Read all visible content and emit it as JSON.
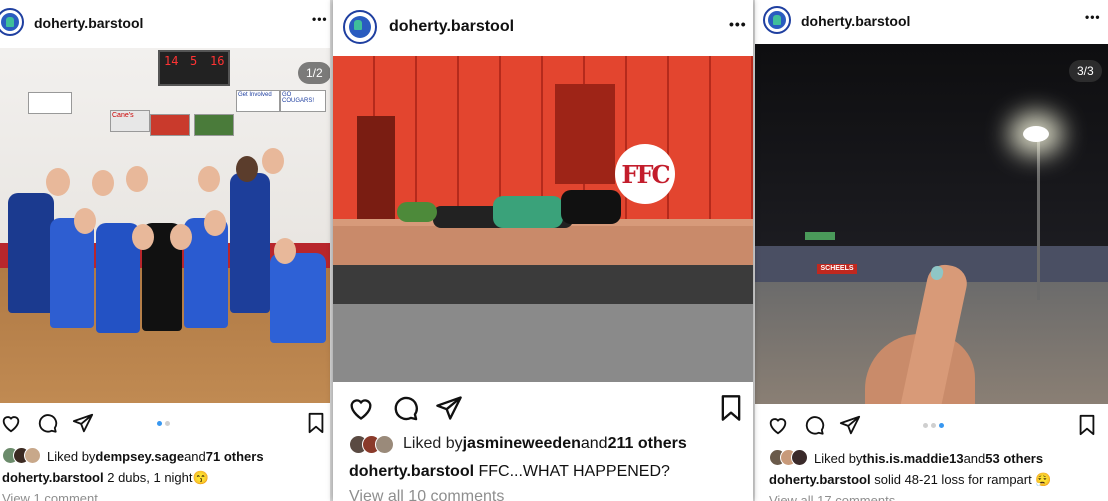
{
  "colors": {
    "link_blue": "#3897f0",
    "school_blue": "#1f3fa0",
    "text": "#111111",
    "muted": "#8e8e8e"
  },
  "posts": [
    {
      "username": "doherty.barstool",
      "more": "•••",
      "counter": "1/2",
      "scoreboard": [
        "14",
        "5",
        "16"
      ],
      "photo_signs": [
        "GO COUGARS!",
        "Get Involved",
        "Cane's",
        "GO COUGARS!"
      ],
      "likes_prefix": "Liked by ",
      "likes_user": "dempsey.sage",
      "likes_and": " and ",
      "likes_others": "71 others",
      "caption_user": "doherty.barstool",
      "caption_text": " 2 dubs, 1 night😙",
      "comments": "View 1 comment",
      "carousel_dots": 2,
      "carousel_active": 0
    },
    {
      "username": "doherty.barstool",
      "more": "•••",
      "logo_text": "FFC",
      "likes_prefix": "Liked by ",
      "likes_user": "jasmineweeden",
      "likes_and": " and ",
      "likes_others": "211 others",
      "caption_user": "doherty.barstool",
      "caption_text": " FFC...WHAT HAPPENED?",
      "comments": "View all 10 comments"
    },
    {
      "username": "doherty.barstool",
      "more": "•••",
      "counter": "3/3",
      "photo_sign": "SCHEELS",
      "likes_prefix": "Liked by ",
      "likes_user": "this.is.maddie13",
      "likes_and": " and ",
      "likes_others": "53 others",
      "caption_user": "doherty.barstool",
      "caption_text": " solid 48-21 loss for rampart 😮‍💨",
      "comments": "View all 17 comments",
      "carousel_dots": 3,
      "carousel_active": 2
    }
  ],
  "icons": [
    "heart-icon",
    "comment-icon",
    "share-icon",
    "bookmark-icon",
    "more-icon"
  ]
}
